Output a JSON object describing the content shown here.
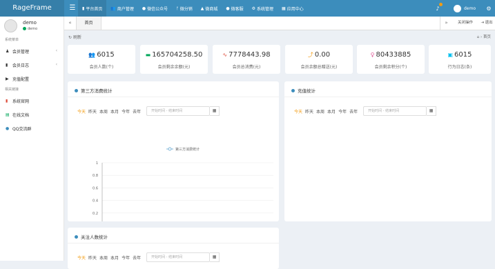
{
  "app": {
    "logo": "RageFrame"
  },
  "topnav": {
    "items": [
      {
        "label": "平台首页",
        "icon": "bookmark-icon",
        "active": true
      },
      {
        "label": "商户管理",
        "icon": "users-icon",
        "active": false
      },
      {
        "label": "微信公众号",
        "icon": "wechat-icon",
        "active": false
      },
      {
        "label": "微分销",
        "icon": "share-icon",
        "active": false
      },
      {
        "label": "微商城",
        "icon": "shop-icon",
        "active": false
      },
      {
        "label": "微客服",
        "icon": "chat-icon",
        "active": false
      },
      {
        "label": "系统管理",
        "icon": "cogs-icon",
        "active": false
      },
      {
        "label": "应用中心",
        "icon": "apps-icon",
        "active": false
      }
    ],
    "user": "demo"
  },
  "sidebar": {
    "user_name": "demo",
    "user_status": "demo",
    "section_system": "系统菜单",
    "section_links": "相关链接",
    "items": [
      {
        "label": "会员管理",
        "icon": "user-icon",
        "caret": true
      },
      {
        "label": "会员日志",
        "icon": "book-icon",
        "caret": true
      },
      {
        "label": "充值配置",
        "icon": "card-icon",
        "caret": false
      }
    ],
    "links": [
      {
        "label": "系统官网",
        "icon": "bookmark-icon"
      },
      {
        "label": "在线文档",
        "icon": "file-icon"
      },
      {
        "label": "QQ交流群",
        "icon": "qq-icon"
      }
    ]
  },
  "tabs": {
    "home": "首页",
    "close_ops": "关闭操作",
    "logout": "退出"
  },
  "content": {
    "refresh": "刷新",
    "breadcrumb": "首页"
  },
  "stats": [
    {
      "value": "6015",
      "label": "会员人数(个)",
      "icon": "users-icon",
      "color": "#3c8dbc"
    },
    {
      "value": "165704258.50",
      "label": "会员剩余余额(元)",
      "icon": "money-icon",
      "color": "#00a65a"
    },
    {
      "value": "7778443.98",
      "label": "会员总消费(元)",
      "icon": "pulse-icon",
      "color": "#dd4b39"
    },
    {
      "value": "0.00",
      "label": "会员余额总赠送(元)",
      "icon": "trend-icon",
      "color": "#f39c12"
    },
    {
      "value": "80433885",
      "label": "会员剩余积分(个)",
      "icon": "pin-icon",
      "color": "#e05d9b"
    },
    {
      "value": "6015",
      "label": "行为日志(条)",
      "icon": "log-icon",
      "color": "#00c0ef"
    }
  ],
  "panels": {
    "consume": {
      "title": "第三方消费统计"
    },
    "recharge": {
      "title": "充值统计"
    },
    "follow": {
      "title": "关注人数统计"
    }
  },
  "filters": {
    "today": "今天",
    "yesterday": "昨天",
    "week": "本周",
    "month": "本月",
    "year": "今年",
    "last_year": "去年",
    "date_placeholder": "开始时间 - 结束时间"
  },
  "chart_data": {
    "type": "line",
    "series": [
      {
        "name": "第三方消费统计",
        "values": [
          0,
          0,
          0,
          0,
          0,
          0,
          0,
          0,
          0,
          0,
          0,
          0,
          0,
          0,
          0,
          0,
          0,
          0,
          0,
          0,
          0,
          0,
          0
        ]
      }
    ],
    "x": [
      "00:00",
      "01:00",
      "02:00",
      "03:00",
      "04:00",
      "05:00",
      "06:00",
      "07:00",
      "08:00",
      "09:00",
      "10:00",
      "11:00",
      "12:00",
      "13:00",
      "14:00",
      "15:00",
      "16:00",
      "17:00",
      "18:00",
      "19:00",
      "20:00",
      "21:00",
      "22:00"
    ],
    "x_tick_labels": [
      "00:00",
      "02:00",
      "04:00",
      "06:00",
      "08:00",
      "10:00",
      "12:00",
      "14:00",
      "16:00",
      "18:00",
      "20:00",
      "22:00"
    ],
    "y_tick_labels": [
      "0",
      "0.2",
      "0.4",
      "0.6",
      "0.8",
      "1"
    ],
    "ylim": [
      0,
      1
    ],
    "legend": "top-center",
    "color": "#7eb6d9"
  }
}
